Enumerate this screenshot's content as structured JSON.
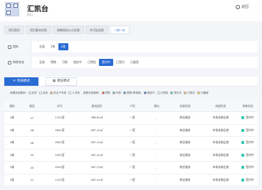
{
  "header": {
    "title": "汇凯台",
    "subtitle": "阳山",
    "back_label": "返回"
  },
  "nav_tabs": [
    "项目首页",
    "项目基本信息",
    "销售现场公示信息",
    "许可证信息",
    "一房一价"
  ],
  "filters": {
    "building": {
      "label": "楼栋",
      "options": [
        "全部",
        "1栋",
        "2栋"
      ],
      "selected": "2栋"
    },
    "status": {
      "label": "销售状态",
      "options": [
        "全部",
        "预售",
        "可售",
        "限定中",
        "已预定",
        "签约中",
        "已签约",
        "已备案"
      ],
      "selected": "签约中"
    }
  },
  "view_tabs": {
    "active": "列表模式",
    "other": "楼层模式"
  },
  "legend": {
    "left_label": "房屋状态图例:",
    "left": [
      {
        "label": "历史",
        "color": "#e8e8e8"
      },
      {
        "label": "自持",
        "color": "#ffffff"
      },
      {
        "label": "拆迁户专用",
        "color": "#f7b46a"
      },
      {
        "label": "人才房",
        "color": "#ffffff"
      }
    ],
    "right_label": "销售状态图例:",
    "right": [
      {
        "label": "预售",
        "color": "#e04a3f"
      },
      {
        "label": "可售",
        "color": "#5dc78b"
      },
      {
        "label": "限售(带视角)",
        "color": "#3a8de0"
      },
      {
        "label": "限定中",
        "color": "#2a6bd4"
      },
      {
        "label": "已预定",
        "color": "#ffffff"
      },
      {
        "label": "签约中",
        "color": "#37c7b6"
      },
      {
        "label": "已签约",
        "color": "#f7b46a"
      },
      {
        "label": "已备案",
        "color": "#f2d34b"
      }
    ]
  },
  "table": {
    "headers": [
      "楼栋",
      "楼层",
      "房号",
      "建筑面积",
      "户型",
      "朝向",
      "房屋用途",
      "房屋性质",
      "销售状态"
    ],
    "rows": [
      [
        "2栋",
        "27",
        "2701室",
        "786.81㎡",
        "一室",
        "-",
        "商业服务",
        "市场化商品房",
        "签约中"
      ],
      [
        "2栋",
        "26",
        "2601室",
        "287.41㎡",
        "一室",
        "-",
        "商业服务",
        "市场化商品房",
        "签约中"
      ],
      [
        "2栋",
        "26",
        "2602室",
        "287.41㎡",
        "一室",
        "-",
        "商业服务",
        "市场化商品房",
        "签约中"
      ],
      [
        "2栋",
        "20",
        "2001室",
        "287.41㎡",
        "一室",
        "-",
        "商业服务",
        "市场化商品房",
        "签约中"
      ],
      [
        "2栋",
        "20",
        "2002室",
        "287.23㎡",
        "一室",
        "-",
        "商业服务",
        "市场化商品房",
        "签约中"
      ],
      [
        "2栋",
        "11",
        "1101室",
        "287.41㎡",
        "一室",
        "-",
        "商业服务",
        "市场化商品房",
        "签约中"
      ]
    ]
  },
  "colors": {
    "accent": "#2a6bd4",
    "status_dot": "#37c7b6"
  }
}
